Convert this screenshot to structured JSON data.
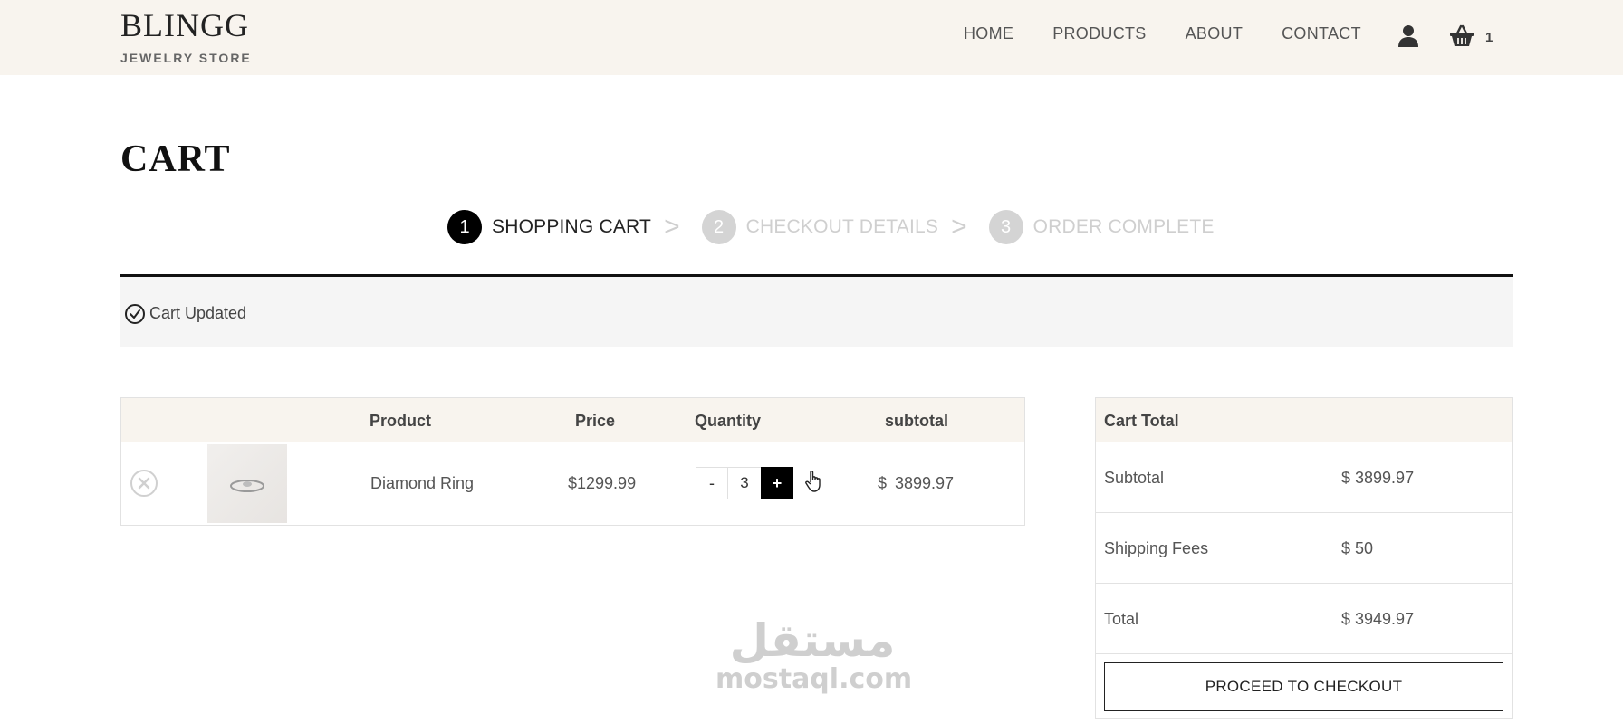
{
  "brand": {
    "name": "BLINGG",
    "subtitle": "JEWELRY STORE"
  },
  "nav": {
    "items": [
      "HOME",
      "PRODUCTS",
      "ABOUT",
      "CONTACT"
    ]
  },
  "header": {
    "user_icon": "user-icon",
    "cart_icon": "basket-icon",
    "cart_count": "1"
  },
  "page": {
    "title": "CART"
  },
  "steps": [
    {
      "num": "1",
      "label": "SHOPPING CART",
      "active": true
    },
    {
      "num": "2",
      "label": "CHECKOUT DETAILS",
      "active": false
    },
    {
      "num": "3",
      "label": "ORDER COMPLETE",
      "active": false
    }
  ],
  "step_separator": ">",
  "notice": {
    "text": "Cart Updated",
    "icon": "check-circle-icon"
  },
  "cart_table": {
    "headers": {
      "product": "Product",
      "price": "Price",
      "quantity": "Quantity",
      "subtotal": "subtotal"
    },
    "rows": [
      {
        "product": "Diamond Ring",
        "price": "$1299.99",
        "quantity": "3",
        "minus": "-",
        "plus": "+",
        "subtotal_currency": "$",
        "subtotal": "3899.97"
      }
    ]
  },
  "cart_total": {
    "title": "Cart Total",
    "rows": [
      {
        "label": "Subtotal",
        "value": "$ 3899.97"
      },
      {
        "label": "Shipping Fees",
        "value": "$ 50"
      },
      {
        "label": "Total",
        "value": "$ 3949.97"
      }
    ],
    "checkout_label": "PROCEED TO CHECKOUT"
  },
  "watermark": {
    "arabic": "مستقل",
    "latin": "mostaql.com"
  },
  "colors": {
    "header_bg": "#f8f4ee",
    "accent": "#000000",
    "inactive": "#d4d4d4",
    "notice_bg": "#f5f5f5"
  }
}
